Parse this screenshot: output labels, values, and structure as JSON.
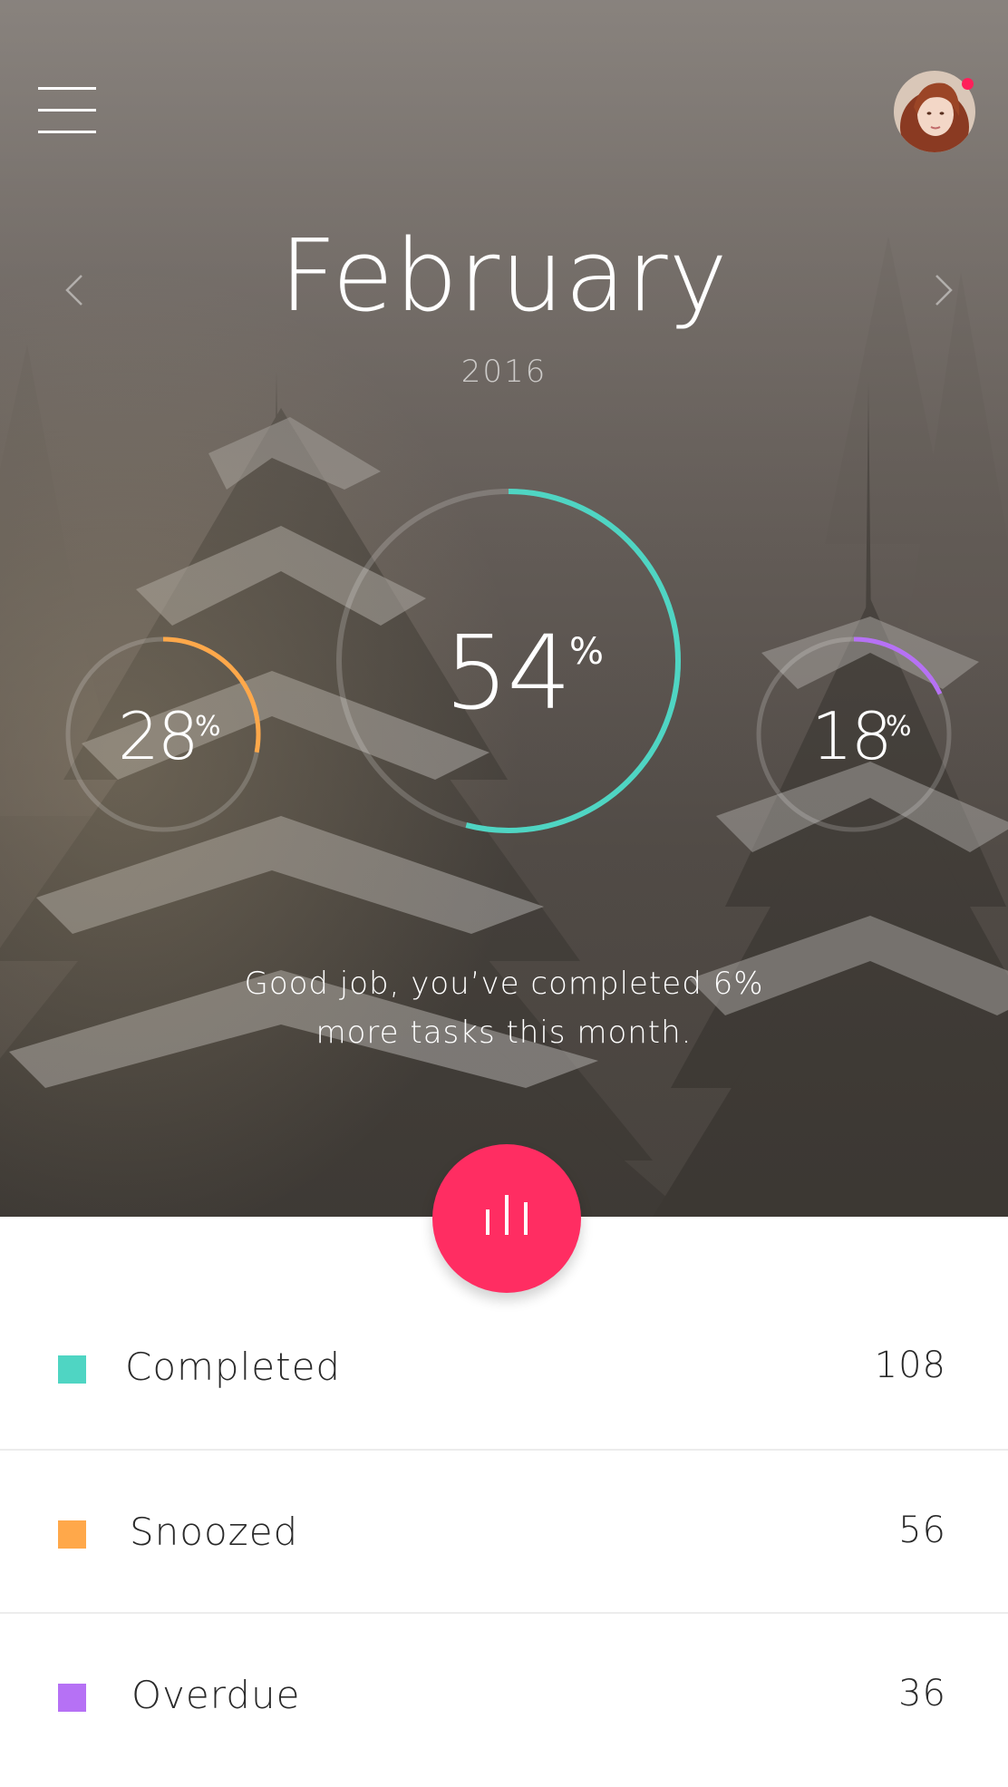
{
  "header": {
    "month": "February",
    "year": "2016",
    "menu_icon": "hamburger-menu-icon",
    "prev_icon": "chevron-left-icon",
    "next_icon": "chevron-right-icon",
    "avatar_has_notification": true
  },
  "gauges": {
    "completed": {
      "value": "54",
      "unit": "%",
      "fraction": 0.54,
      "color": "#4fd5c3"
    },
    "snoozed": {
      "value": "28",
      "unit": "%",
      "fraction": 0.28,
      "color": "#ffa84a"
    },
    "overdue": {
      "value": "18",
      "unit": "%",
      "fraction": 0.18,
      "color": "#b671f5"
    }
  },
  "message": {
    "line1": "Good job, you’ve completed 6%",
    "line2": "more tasks this month."
  },
  "fab": {
    "icon": "bar-chart-icon",
    "color": "#ff2d62"
  },
  "legend": [
    {
      "label": "Completed",
      "count": "108",
      "color": "#4fd5c3"
    },
    {
      "label": "Snoozed",
      "count": "56",
      "color": "#ffa84a"
    },
    {
      "label": "Overdue",
      "count": "36",
      "color": "#b671f5"
    }
  ]
}
